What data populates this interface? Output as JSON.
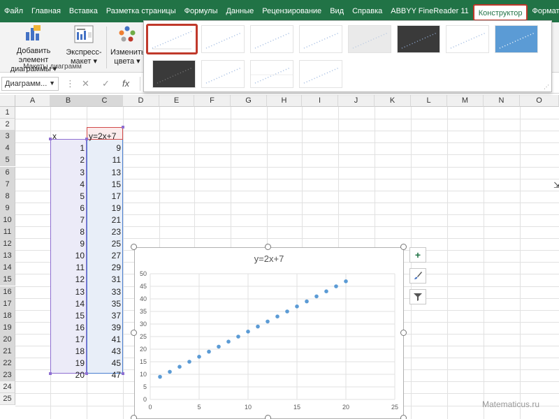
{
  "tabs": [
    "Файл",
    "Главная",
    "Вставка",
    "Разметка страницы",
    "Формулы",
    "Данные",
    "Рецензирование",
    "Вид",
    "Справка",
    "ABBYY FineReader 11",
    "Конструктор",
    "Формат"
  ],
  "ribbon": {
    "add_element": "Добавить элемент диаграммы",
    "add_element_arrow": "▾",
    "express_layout": "Экспресс-макет",
    "express_layout_arrow": "▾",
    "change_colors": "Изменить цвета",
    "change_colors_arrow": "▾",
    "group_label": "Макеты диаграмм"
  },
  "formula_bar": {
    "name_box": "Диаграмм...",
    "cancel": "✕",
    "confirm": "✓",
    "fx": "fx",
    "formula": ""
  },
  "columns": [
    "A",
    "B",
    "C",
    "D",
    "E",
    "F",
    "G",
    "H",
    "I",
    "J",
    "K",
    "L",
    "M",
    "N",
    "O"
  ],
  "rows": [
    "1",
    "2",
    "3",
    "4",
    "5",
    "6",
    "7",
    "8",
    "9",
    "10",
    "11",
    "12",
    "13",
    "14",
    "15",
    "16",
    "17",
    "18",
    "19",
    "20",
    "21",
    "22",
    "23",
    "24",
    "25"
  ],
  "table": {
    "header_x": "x",
    "header_y": "y=2x+7",
    "x_values": [
      "1",
      "2",
      "3",
      "4",
      "5",
      "6",
      "7",
      "8",
      "9",
      "10",
      "11",
      "12",
      "13",
      "14",
      "15",
      "16",
      "17",
      "18",
      "19",
      "20"
    ],
    "y_values": [
      "9",
      "11",
      "13",
      "15",
      "17",
      "19",
      "21",
      "23",
      "25",
      "27",
      "29",
      "31",
      "33",
      "35",
      "37",
      "39",
      "41",
      "43",
      "45",
      "47"
    ]
  },
  "chart_data": {
    "type": "scatter",
    "title": "y=2x+7",
    "x": [
      1,
      2,
      3,
      4,
      5,
      6,
      7,
      8,
      9,
      10,
      11,
      12,
      13,
      14,
      15,
      16,
      17,
      18,
      19,
      20
    ],
    "y": [
      9,
      11,
      13,
      15,
      17,
      19,
      21,
      23,
      25,
      27,
      29,
      31,
      33,
      35,
      37,
      39,
      41,
      43,
      45,
      47
    ],
    "xlim": [
      0,
      25
    ],
    "ylim": [
      0,
      50
    ],
    "x_ticks": [
      "0",
      "5",
      "10",
      "15",
      "20",
      "25"
    ],
    "y_ticks": [
      "0",
      "5",
      "10",
      "15",
      "20",
      "25",
      "30",
      "35",
      "40",
      "45",
      "50"
    ],
    "grid": true,
    "marker_color": "#5b9bd5"
  },
  "chart_tools": {
    "add": "+",
    "style": "brush-icon",
    "filter": "filter-icon"
  },
  "watermark": "Matematicus.ru",
  "colors": {
    "excel_green": "#217346",
    "active_tab_border": "#c0392b",
    "marker": "#5b9bd5"
  }
}
